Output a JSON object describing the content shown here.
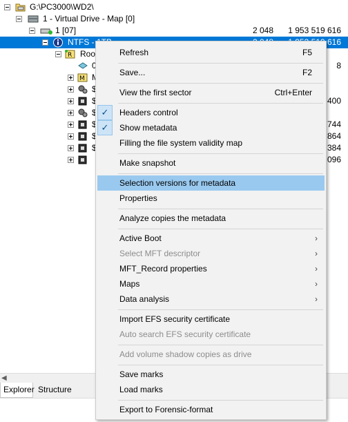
{
  "tree": {
    "rows": [
      {
        "label": "G:\\PC3000\\WD2\\"
      },
      {
        "label": "1 - Virtual Drive - Map [0]"
      },
      {
        "label": "1 [07]",
        "col1": "2 048",
        "col2": "1 953 519 616"
      },
      {
        "label": "NTFS - 1TB",
        "col1": "2 048",
        "col2": "1 953 519 616"
      },
      {
        "label": "Root"
      }
    ],
    "child_letters": [
      "0",
      "M",
      "$",
      "$",
      "$",
      "$",
      "$",
      "$"
    ],
    "right_fragments": [
      "8",
      "400",
      "744",
      "864",
      "384",
      "096"
    ],
    "icons": [
      "drive-folder-icon",
      "disk-icon",
      "partition-icon",
      "info-icon",
      "root-folder-icon",
      "file-icon",
      "mft-icon",
      "gears-icon",
      "cube-icon",
      "gears-icon",
      "cube-icon",
      "cube-icon",
      "cube-icon",
      "cube-icon"
    ]
  },
  "tabs": [
    {
      "label": "Explorer"
    },
    {
      "label": "Structure"
    }
  ],
  "context_menu": {
    "items": [
      {
        "label": "Refresh",
        "shortcut": "F5"
      },
      {
        "label": "Save...",
        "shortcut": "F2"
      },
      {
        "label": "View the first sector",
        "shortcut": "Ctrl+Enter"
      },
      {
        "label": "Headers control",
        "checked": true
      },
      {
        "label": "Show metadata",
        "checked": true
      },
      {
        "label": "Filling the file system validity map"
      },
      {
        "label": "Make snapshot"
      },
      {
        "label": "Selection versions for metadata",
        "highlighted": true
      },
      {
        "label": "Properties"
      },
      {
        "label": "Analyze copies the metadata"
      },
      {
        "label": "Active Boot",
        "submenu": true
      },
      {
        "label": "Select MFT descriptor",
        "submenu": true,
        "disabled": true
      },
      {
        "label": "MFT_Record properties",
        "submenu": true
      },
      {
        "label": "Maps",
        "submenu": true
      },
      {
        "label": "Data analysis",
        "submenu": true
      },
      {
        "label": "Import EFS security certificate"
      },
      {
        "label": "Auto search EFS security certificate",
        "disabled": true
      },
      {
        "label": "Add volume shadow copies as drive",
        "disabled": true
      },
      {
        "label": "Save marks"
      },
      {
        "label": "Load marks"
      },
      {
        "label": "Export to Forensic-format"
      }
    ]
  },
  "colors": {
    "selection": "#0078d7",
    "menu_background": "#f2f2f2",
    "menu_highlight": "#99c9ef",
    "disabled_text": "#8c8c8c"
  }
}
